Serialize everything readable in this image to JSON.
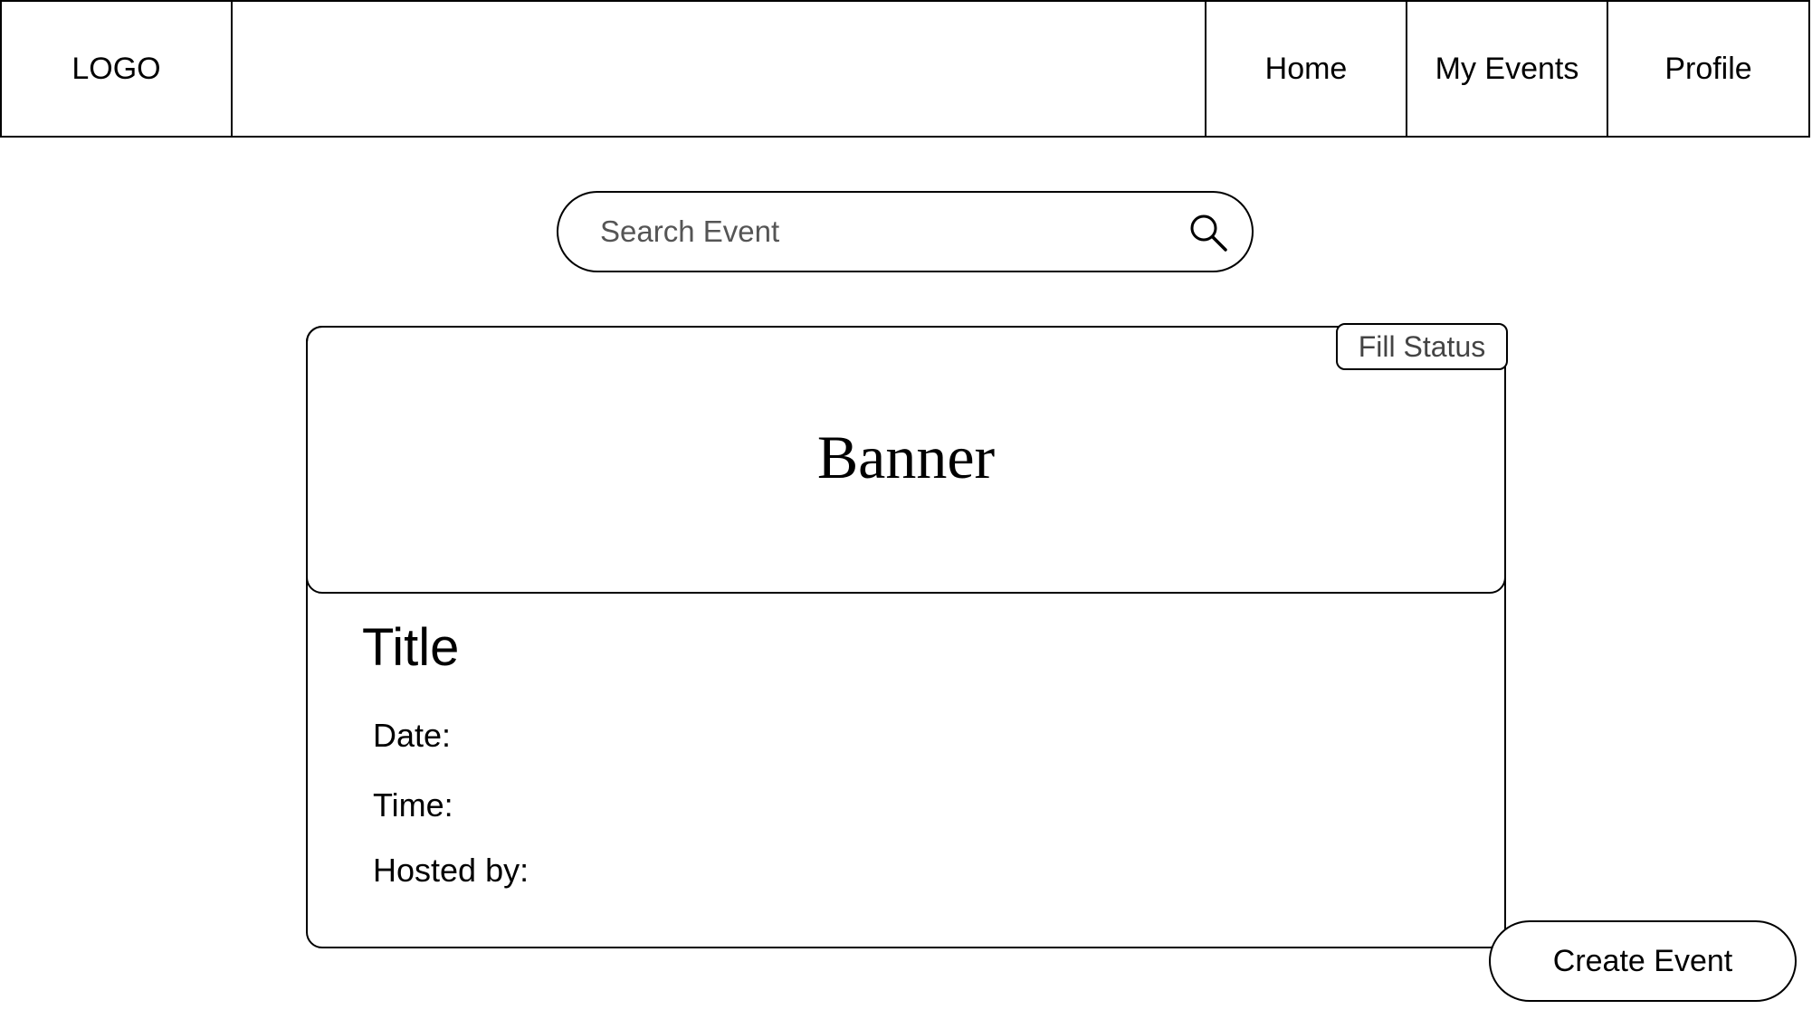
{
  "navbar": {
    "logo": "LOGO",
    "links": [
      {
        "label": "Home"
      },
      {
        "label": "My Events"
      },
      {
        "label": "Profile"
      }
    ]
  },
  "search": {
    "placeholder": "Search Event",
    "icon": "search-icon"
  },
  "event_card": {
    "banner": "Banner",
    "status_badge": "Fill Status",
    "title": "Title",
    "fields": {
      "date": "Date:",
      "time": "Time:",
      "hosted_by": "Hosted by:"
    }
  },
  "actions": {
    "create_event": "Create Event"
  }
}
